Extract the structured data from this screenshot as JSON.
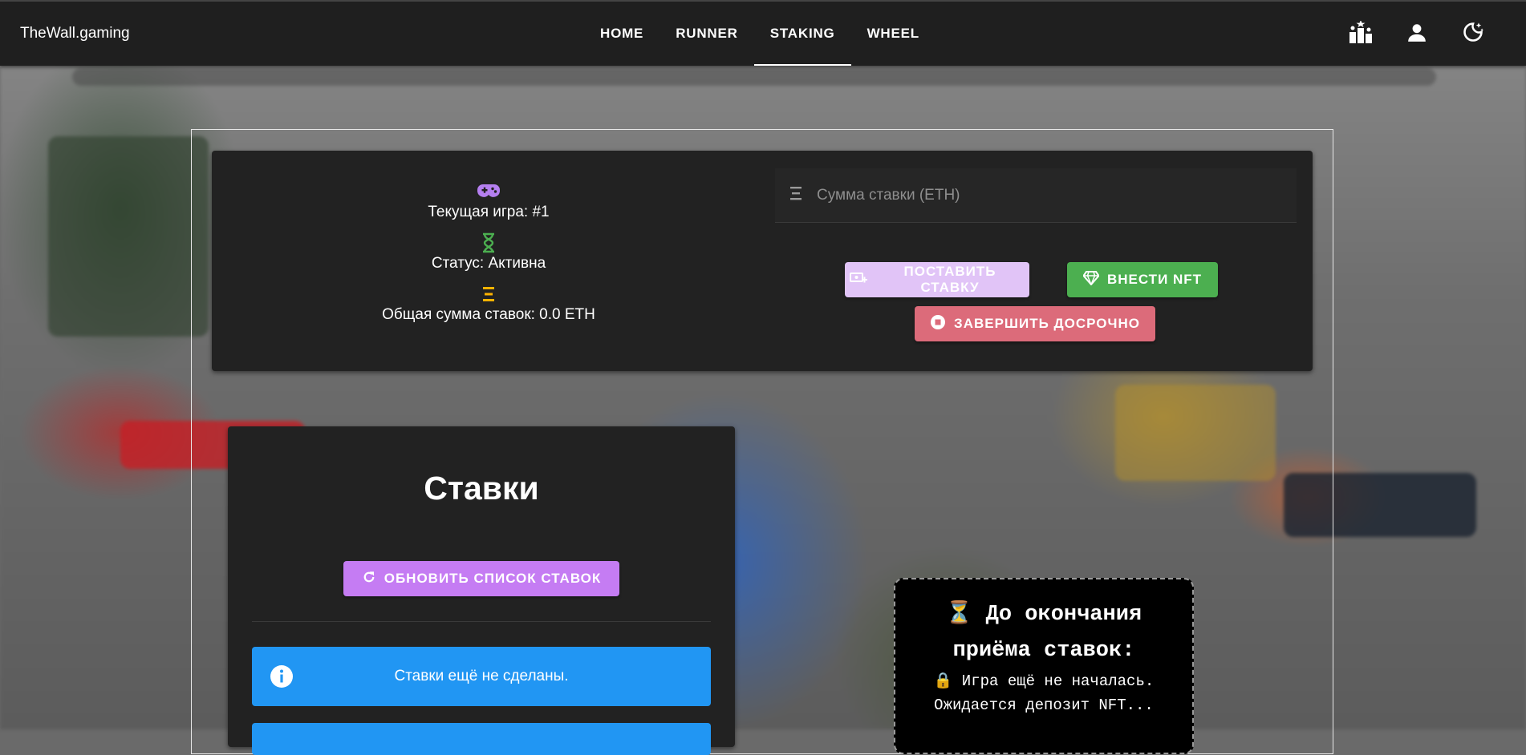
{
  "app": {
    "brand": "TheWall.gaming"
  },
  "nav": {
    "items": [
      {
        "label": "HOME",
        "active": false
      },
      {
        "label": "RUNNER",
        "active": false
      },
      {
        "label": "STAKING",
        "active": true
      },
      {
        "label": "WHEEL",
        "active": false
      }
    ]
  },
  "top_icons": [
    "leaderboard-icon",
    "account-icon",
    "theme-toggle-icon"
  ],
  "game": {
    "current_game": "Текущая игра: #1",
    "status": "Статус: Активна",
    "total": "Общая сумма ставок: 0.0 ETH"
  },
  "stake": {
    "placeholder": "Сумма ставки (ETH)",
    "place_bet": "ПОСТАВИТЬ СТАВКУ",
    "deposit_nft": "ВНЕСТИ NFT",
    "finish_early": "ЗАВЕРШИТЬ ДОСРОЧНО"
  },
  "bets": {
    "title": "Ставки",
    "refresh": "ОБНОВИТЬ СПИСОК СТАВОК",
    "empty": "Ставки ещё не сделаны."
  },
  "countdown": {
    "title_line1": "⏳ До окончания",
    "title_line2": "приёма ставок:",
    "line1": "🔒 Игра ещё не началась.",
    "line2": "Ожидается депозит NFT..."
  },
  "colors": {
    "gamepad": "#b57ff0",
    "hourglass": "#4caf50",
    "eth": "#ffb300",
    "info_alert": "#2196f3"
  }
}
